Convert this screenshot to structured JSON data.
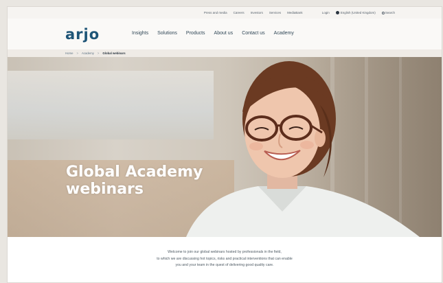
{
  "utility_nav": {
    "items": [
      "Press and media",
      "Careers",
      "Investors",
      "Services",
      "MediaBank"
    ],
    "login": "Login",
    "language": "English (United Kingdom)",
    "search": "Search"
  },
  "brand": {
    "logo_text": "arjo"
  },
  "main_nav": {
    "items": [
      "Insights",
      "Solutions",
      "Products",
      "About us",
      "Contact us",
      "Academy"
    ]
  },
  "breadcrumb": {
    "items": [
      "Home",
      "Academy"
    ],
    "current": "Global webinars"
  },
  "hero": {
    "title_line1": "Global Academy",
    "title_line2": "webinars"
  },
  "intro": {
    "line1": "Welcome to join our global webinars hosted by professionals in the field,",
    "line2": "to which we are discussing hot topics, risks and practical interventions that can enable",
    "line3": "you and your team in the quest of delivering good quality care."
  },
  "colors": {
    "brand_blue": "#1e5577",
    "nav_text": "#2f4656",
    "breadcrumb_bg": "#efebe6"
  }
}
